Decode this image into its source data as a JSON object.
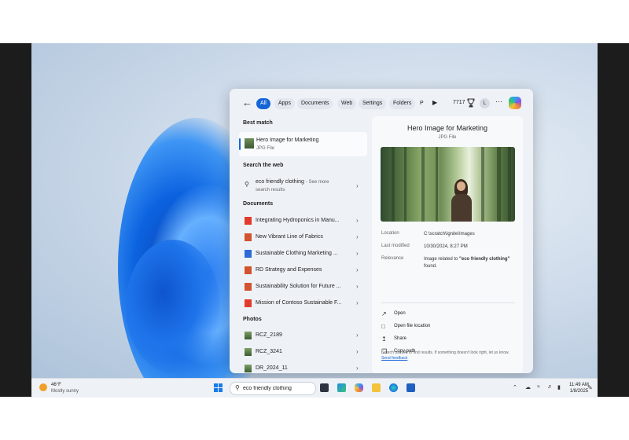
{
  "tabs": [
    "All",
    "Apps",
    "Documents",
    "Web",
    "Settings",
    "Folders",
    "P"
  ],
  "points": "7717",
  "user_initial": "L",
  "best_match": {
    "heading": "Best match",
    "title": "Hero Image for Marketing",
    "subtitle": "JPG File"
  },
  "web": {
    "heading": "Search the web",
    "query": "eco friendly clothing",
    "see_more": "- See more",
    "results": "search results"
  },
  "documents": {
    "heading": "Documents",
    "items": [
      {
        "name": "Integrating Hydroponics in Manu...",
        "icon": "pdf-icon"
      },
      {
        "name": "New Vibrant Line of Fabrics",
        "icon": "ppt-icon"
      },
      {
        "name": "Sustainable Clothing Marketing ...",
        "icon": "word-icon"
      },
      {
        "name": "RD Strategy and Expenses",
        "icon": "ppt-icon"
      },
      {
        "name": "Sustainability Solution for Future ...",
        "icon": "ppt-icon"
      },
      {
        "name": "Mission of Contoso Sustainable F...",
        "icon": "pdf-icon"
      }
    ]
  },
  "photos": {
    "heading": "Photos",
    "items": [
      "RCZ_2189",
      "RCZ_3241",
      "DR_2024_11"
    ]
  },
  "preview": {
    "title": "Hero Image for Marketing",
    "subtitle": "JPG File",
    "location_label": "Location",
    "location_value": "C:\\scratch\\Ignite\\Images",
    "modified_label": "Last modified",
    "modified_value": "10/30/2024, 8:27 PM",
    "relevance_label": "Relevance",
    "relevance_prefix": "Image related to",
    "relevance_term": "\"eco friendly clothing\"",
    "relevance_suffix": "found.",
    "actions": [
      "Open",
      "Open file location",
      "Share",
      "Copy path"
    ],
    "feedback_text": "Search uses AI to find results. If something doesn't look right, let us know.",
    "feedback_link": "Send feedback"
  },
  "taskbar": {
    "temperature": "46°F",
    "weather": "Mostly sunny",
    "search_value": "eco friendly clothing",
    "time": "11:49 AM",
    "date": "1/8/2025"
  },
  "colors": {
    "accent": "#1565d8",
    "panel_bg": "#eef2f7"
  }
}
